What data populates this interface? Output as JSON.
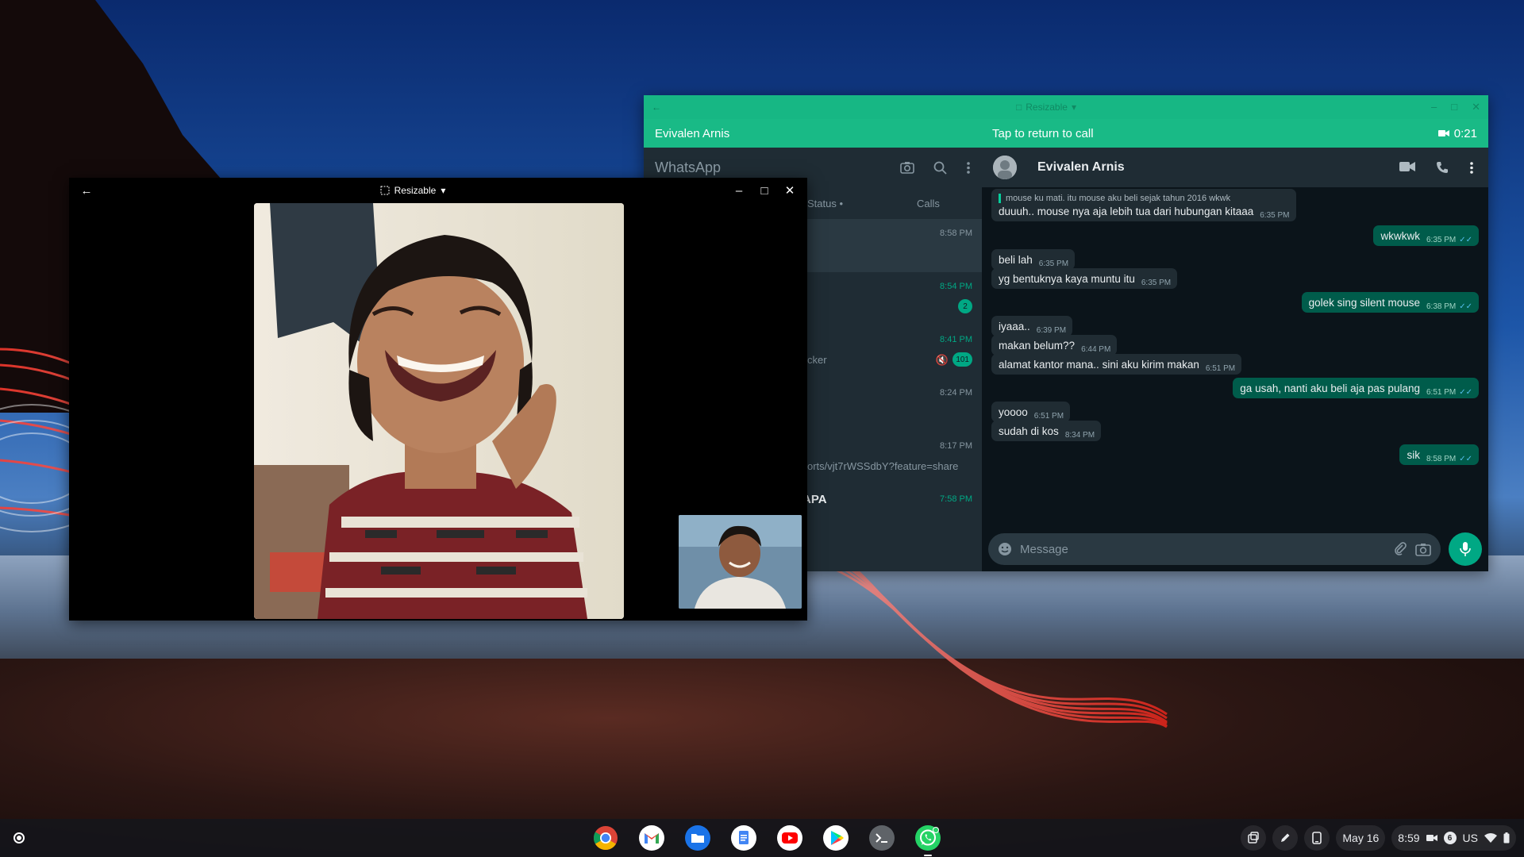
{
  "video_call": {
    "title_mode": "Resizable",
    "back_icon": "arrow-left-icon",
    "controls": [
      "minimize-icon",
      "maximize-icon",
      "close-icon"
    ]
  },
  "whatsapp": {
    "titlebar_mode": "Resizable",
    "banner": {
      "contact": "Evivalen Arnis",
      "return_text": "Tap to return to call",
      "duration": "0:21"
    },
    "list": {
      "brand": "WhatsApp",
      "tab_status": "Status •",
      "tab_calls": "Calls",
      "rows": [
        {
          "time": "8:58 PM",
          "time_green": false,
          "badge": "",
          "snippet": "",
          "name": "",
          "muted": false,
          "selected": true
        },
        {
          "time": "8:54 PM",
          "time_green": true,
          "badge": "2",
          "snippet": "",
          "name": "",
          "muted": false,
          "selected": false
        },
        {
          "time": "8:41 PM",
          "time_green": true,
          "badge": "101",
          "snippet": "cker",
          "name": "",
          "muted": true,
          "selected": false
        },
        {
          "time": "8:24 PM",
          "time_green": false,
          "badge": "",
          "snippet": "",
          "name": "",
          "muted": false,
          "selected": false
        },
        {
          "time": "8:17 PM",
          "time_green": false,
          "badge": "",
          "snippet": "orts/vjt7rWSSdbY?feature=share",
          "name": "",
          "muted": false,
          "selected": false
        },
        {
          "time": "7:58 PM",
          "time_green": true,
          "badge": "",
          "snippet": "",
          "name": "APA",
          "muted": false,
          "selected": false
        }
      ],
      "fab_badge": "15"
    },
    "chat": {
      "contact": "Evivalen Arnis",
      "messages": [
        {
          "dir": "in",
          "quote": "mouse ku mati. itu mouse aku beli sejak tahun 2016 wkwk",
          "text": "duuuh.. mouse nya aja lebih tua dari hubungan kitaaa",
          "time": "6:35 PM"
        },
        {
          "dir": "out",
          "text": "wkwkwk",
          "time": "6:35 PM"
        },
        {
          "dir": "in",
          "text": "beli lah",
          "time": "6:35 PM"
        },
        {
          "dir": "in",
          "text": "yg bentuknya kaya muntu itu",
          "time": "6:35 PM"
        },
        {
          "dir": "out",
          "text": "golek sing silent mouse",
          "time": "6:38 PM"
        },
        {
          "dir": "in",
          "text": "iyaaa..",
          "time": "6:39 PM"
        },
        {
          "dir": "in",
          "text": "makan belum??",
          "time": "6:44 PM"
        },
        {
          "dir": "in",
          "text": "alamat kantor mana.. sini aku kirim makan",
          "time": "6:51 PM"
        },
        {
          "dir": "out",
          "text": "ga usah, nanti aku beli aja pas pulang",
          "time": "6:51 PM"
        },
        {
          "dir": "in",
          "text": "yoooo",
          "time": "6:51 PM"
        },
        {
          "dir": "in",
          "text": "sudah di kos",
          "time": "8:34 PM"
        },
        {
          "dir": "out",
          "text": "sik",
          "time": "8:58 PM"
        }
      ],
      "input_placeholder": "Message"
    }
  },
  "shelf": {
    "apps": [
      "chrome-icon",
      "gmail-icon",
      "files-icon",
      "docs-icon",
      "youtube-icon",
      "play-store-icon",
      "terminal-icon",
      "whatsapp-icon"
    ],
    "date": "May 16",
    "time": "8:59",
    "notification_count": "6",
    "locale": "US",
    "colors": {
      "whatsapp_green": "#19ba86",
      "accent": "#00a884",
      "outgoing_bubble": "#005c4b",
      "incoming_bubble": "#202c33"
    }
  }
}
